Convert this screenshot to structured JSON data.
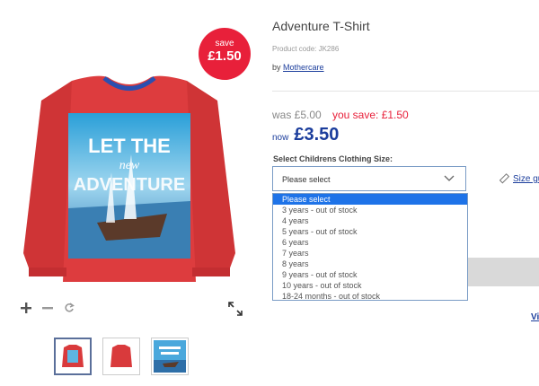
{
  "badge": {
    "line1": "save",
    "line2": "£1.50"
  },
  "product": {
    "title": "Adventure T-Shirt",
    "code": "Product code: JK286",
    "by_prefix": "by",
    "brand": "Mothercare"
  },
  "price": {
    "was": "was £5.00",
    "you_save": "you save: £1.50",
    "now_label": "now",
    "now_value": "£3.50"
  },
  "size": {
    "label": "Select Childrens Clothing Size:",
    "selected": "Please select",
    "options": [
      "Please select",
      "3 years - out of stock",
      "4 years",
      "5 years - out of stock",
      "6 years",
      "7 years",
      "8 years",
      "9 years - out of stock",
      "10 years - out of stock",
      "18-24 months - out of stock"
    ],
    "guide": "Size gu"
  },
  "view_link": "Vi",
  "shirt_print": {
    "line1": "LET THE",
    "line2": "new",
    "line3": "ADVENTURE"
  },
  "colors": {
    "shirt": "#d93a3c",
    "accent": "#1e73e8",
    "badge": "#e8203a",
    "brand_link": "#1b3d9c"
  },
  "icons": [
    "zoom-in-icon",
    "zoom-out-icon",
    "reset-icon",
    "expand-icon",
    "chevron-down-icon",
    "ruler-icon"
  ]
}
